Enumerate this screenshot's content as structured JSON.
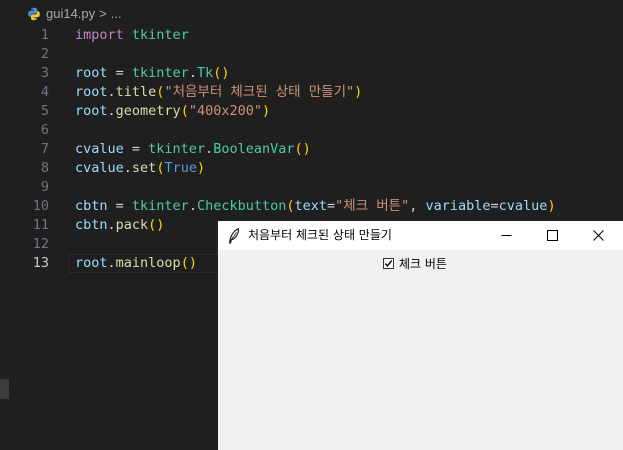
{
  "editor": {
    "breadcrumb": {
      "file": "gui14.py",
      "separator": ">",
      "symbol": "...",
      "file_icon": "python-icon"
    },
    "active_line": 13,
    "lines": [
      {
        "n": "1",
        "tokens": [
          [
            "kw",
            "import"
          ],
          [
            "op",
            " "
          ],
          [
            "mod",
            "tkinter"
          ]
        ]
      },
      {
        "n": "2",
        "tokens": []
      },
      {
        "n": "3",
        "tokens": [
          [
            "var",
            "root"
          ],
          [
            "op",
            " = "
          ],
          [
            "mod",
            "tkinter"
          ],
          [
            "op",
            "."
          ],
          [
            "mod",
            "Tk"
          ],
          [
            "par1",
            "()"
          ]
        ]
      },
      {
        "n": "4",
        "tokens": [
          [
            "var",
            "root"
          ],
          [
            "op",
            "."
          ],
          [
            "fn",
            "title"
          ],
          [
            "par1",
            "("
          ],
          [
            "str",
            "\"처음부터 체크된 상태 만들기\""
          ],
          [
            "par1",
            ")"
          ]
        ]
      },
      {
        "n": "5",
        "tokens": [
          [
            "var",
            "root"
          ],
          [
            "op",
            "."
          ],
          [
            "fn",
            "geometry"
          ],
          [
            "par1",
            "("
          ],
          [
            "str",
            "\"400x200\""
          ],
          [
            "par1",
            ")"
          ]
        ]
      },
      {
        "n": "6",
        "tokens": []
      },
      {
        "n": "7",
        "tokens": [
          [
            "var",
            "cvalue"
          ],
          [
            "op",
            " = "
          ],
          [
            "mod",
            "tkinter"
          ],
          [
            "op",
            "."
          ],
          [
            "mod",
            "BooleanVar"
          ],
          [
            "par1",
            "()"
          ]
        ]
      },
      {
        "n": "8",
        "tokens": [
          [
            "var",
            "cvalue"
          ],
          [
            "op",
            "."
          ],
          [
            "fn",
            "set"
          ],
          [
            "par1",
            "("
          ],
          [
            "const",
            "True"
          ],
          [
            "par1",
            ")"
          ]
        ]
      },
      {
        "n": "9",
        "tokens": []
      },
      {
        "n": "10",
        "tokens": [
          [
            "var",
            "cbtn"
          ],
          [
            "op",
            " = "
          ],
          [
            "mod",
            "tkinter"
          ],
          [
            "op",
            "."
          ],
          [
            "mod",
            "Checkbutton"
          ],
          [
            "par1",
            "("
          ],
          [
            "param",
            "text"
          ],
          [
            "op",
            "="
          ],
          [
            "str",
            "\"체크 버튼\""
          ],
          [
            "op",
            ", "
          ],
          [
            "param",
            "variable"
          ],
          [
            "op",
            "="
          ],
          [
            "var",
            "cvalue"
          ],
          [
            "par1",
            ")"
          ]
        ]
      },
      {
        "n": "11",
        "tokens": [
          [
            "var",
            "cbtn"
          ],
          [
            "op",
            "."
          ],
          [
            "fn",
            "pack"
          ],
          [
            "par1",
            "()"
          ]
        ]
      },
      {
        "n": "12",
        "tokens": []
      },
      {
        "n": "13",
        "tokens": [
          [
            "var",
            "root"
          ],
          [
            "op",
            "."
          ],
          [
            "fn",
            "mainloop"
          ],
          [
            "par1",
            "()"
          ]
        ]
      }
    ]
  },
  "tk_window": {
    "title": "처음부터 체크된 상태 만들기",
    "app_icon": "feather-icon",
    "controls": {
      "minimize": "minimize-icon",
      "maximize": "maximize-icon",
      "close": "close-icon"
    },
    "checkbutton": {
      "label": "체크 버튼",
      "checked": true
    }
  },
  "colors": {
    "editor_bg": "#1f1f1f",
    "keyword": "#c586c0",
    "variable": "#9cdcfe",
    "class": "#4ec9b0",
    "function": "#dcdcaa",
    "string": "#ce9178",
    "constant": "#569cd6",
    "bracket": "#ffd700",
    "window_bg": "#f0f0f0",
    "titlebar_bg": "#ffffff"
  }
}
